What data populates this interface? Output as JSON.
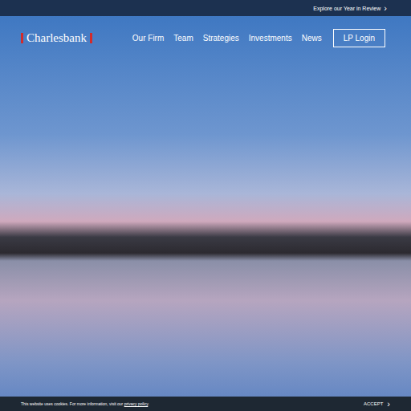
{
  "top_bar": {
    "link": "Explore our Year in Review",
    "arrow": "›"
  },
  "logo": {
    "text": "Charlesbank"
  },
  "nav": {
    "items": [
      "Our Firm",
      "Team",
      "Strategies",
      "Investments",
      "News"
    ],
    "login": "LP Login"
  },
  "cookie_bar": {
    "text": "This website uses cookies. For more information, visit our ",
    "link": "privacy policy",
    "end": ".",
    "button": "ACCEPT",
    "arrow": "›"
  }
}
